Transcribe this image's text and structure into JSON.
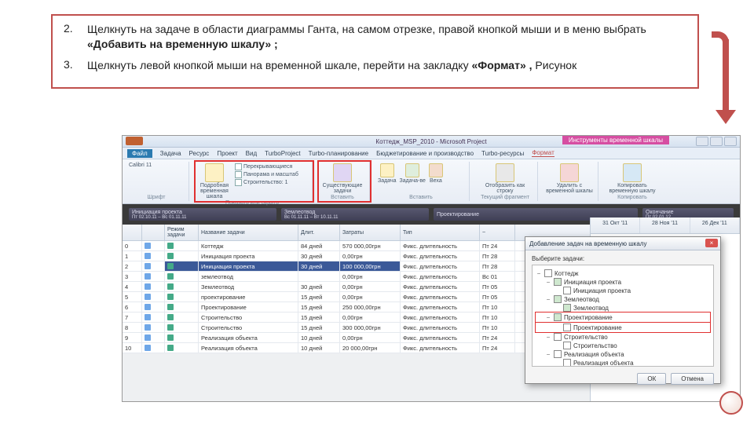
{
  "instructions": {
    "n2": "2.",
    "t2a": "Щелкнуть на задаче в области диаграммы Ганта, на самом отрезке, правой кнопкой мыши и в меню выбрать ",
    "t2b": "«Добавить на временную шкалу» ;",
    "n3": "3.",
    "t3a": "Щелкнуть левой кнопкой мыши на временной шкале, перейти на закладку ",
    "t3b": "«Формат» ,",
    "t3c": " Рисунок"
  },
  "titlebar": {
    "title": "Коттедж_MSP_2010 - Microsoft Project",
    "tool": "Инструменты временной шкалы"
  },
  "tabs": {
    "file": "Файл",
    "t": [
      "Задача",
      "Ресурс",
      "Проект",
      "Вид",
      "TurboProject",
      "Turbo-планирование",
      "Бюджетирование и производство",
      "Turbo-ресурсы"
    ],
    "active": "Формат"
  },
  "ribbon": {
    "g1": {
      "font": "Calibri",
      "size": "11",
      "label": "Шрифт"
    },
    "g2": {
      "btn": "Подробная временная шкала",
      "label": "Показать или скрыть",
      "c1": "Перекрывающиеся",
      "c2": "Панорама и масштаб",
      "c3": "Строительство: 1"
    },
    "g3": {
      "btn": "Существующие задачи",
      "label": "Вставить"
    },
    "g4": {
      "b1": "Задача",
      "b2": "Задача-ве",
      "b3": "Веха",
      "label": "Вставить"
    },
    "g5": {
      "b": "Отобразить как строку",
      "label": "Текущий фрагмент"
    },
    "g6": {
      "b": "Удалить с временной шкалы",
      "label": ""
    },
    "g7": {
      "b": "Копировать временную шкалу",
      "label": "Копировать"
    }
  },
  "segments": {
    "s1t": "Инициация проекта",
    "s1d": "Пт 02.10.11 – Вс 01.11.11",
    "s2t": "Землеотвод",
    "s2d": "Вс 01.11.11 – Вт 10.11.11",
    "s3t": "Проектирование",
    "s3d": "",
    "s4t": "Окончание",
    "s4d": "Пт 02.01.12"
  },
  "columns": {
    "c0": "",
    "c1": "Режим задачи",
    "c2": "Название задачи",
    "c3": "Длит.",
    "c4": "Затраты",
    "c5": "Тип",
    "c6": "~"
  },
  "rows": [
    {
      "id": "0",
      "name": "Коттедж",
      "dur": "84 дней",
      "cost": "570 000,00грн",
      "type": "Фикс. длительность",
      "st": "Пт 24"
    },
    {
      "id": "1",
      "name": "Инициация проекта",
      "dur": "30 дней",
      "cost": "0,00грн",
      "type": "Фикс. длительность",
      "st": "Пт 28",
      "sel": false
    },
    {
      "id": "2",
      "name": "Инициация проекта",
      "dur": "30 дней",
      "cost": "100 000,00грн",
      "type": "Фикс. длительность",
      "st": "Пт 28",
      "sel": true
    },
    {
      "id": "3",
      "name": "землеотвод",
      "dur": "",
      "cost": "0,00грн",
      "type": "Фикс. длительность",
      "st": "Вс 01"
    },
    {
      "id": "4",
      "name": "Землеотвод",
      "dur": "30 дней",
      "cost": "0,00грн",
      "type": "Фикс. длительность",
      "st": "Пт 05"
    },
    {
      "id": "5",
      "name": "проектирование",
      "dur": "15 дней",
      "cost": "0,00грн",
      "type": "Фикс. длительность",
      "st": "Пт 05"
    },
    {
      "id": "6",
      "name": "Проектирование",
      "dur": "15 дней",
      "cost": "250 000,00грн",
      "type": "Фикс. длительность",
      "st": "Пт 10"
    },
    {
      "id": "7",
      "name": "Строительство",
      "dur": "15 дней",
      "cost": "0,00грн",
      "type": "Фикс. длительность",
      "st": "Пт 10"
    },
    {
      "id": "8",
      "name": "Строительство",
      "dur": "15 дней",
      "cost": "300 000,00грн",
      "type": "Фикс. длительность",
      "st": "Пт 10"
    },
    {
      "id": "9",
      "name": "Реализация объекта",
      "dur": "10 дней",
      "cost": "0,00грн",
      "type": "Фикс. длительность",
      "st": "Пт 24"
    },
    {
      "id": "10",
      "name": "Реализация объекта",
      "dur": "10 дней",
      "cost": "20 000,00грн",
      "type": "Фикс. длительность",
      "st": "Пт 24"
    }
  ],
  "gantt_dates": [
    "31 Окт '11",
    "28 Ноя '11",
    "26 Дек '11"
  ],
  "dialog": {
    "title": "Добавление задач на временную шкалу",
    "label": "Выберите задачи:",
    "tree": [
      {
        "lvl": 0,
        "pm": "−",
        "chk": false,
        "txt": "Коттедж"
      },
      {
        "lvl": 1,
        "pm": "−",
        "chk": true,
        "txt": "Инициация проекта"
      },
      {
        "lvl": 2,
        "pm": "",
        "chk": false,
        "txt": "Инициация проекта"
      },
      {
        "lvl": 1,
        "pm": "−",
        "chk": true,
        "txt": "Землеотвод"
      },
      {
        "lvl": 2,
        "pm": "",
        "chk": true,
        "txt": "Землеотвод"
      },
      {
        "lvl": 1,
        "pm": "−",
        "chk": true,
        "txt": "Проектирование",
        "red": true
      },
      {
        "lvl": 2,
        "pm": "",
        "chk": false,
        "txt": "Проектирование",
        "red": true
      },
      {
        "lvl": 1,
        "pm": "−",
        "chk": false,
        "txt": "Строительство"
      },
      {
        "lvl": 2,
        "pm": "",
        "chk": false,
        "txt": "Строительство"
      },
      {
        "lvl": 1,
        "pm": "−",
        "chk": false,
        "txt": "Реализация объекта"
      },
      {
        "lvl": 2,
        "pm": "",
        "chk": false,
        "txt": "Реализация объекта"
      }
    ],
    "ok": "ОК",
    "cancel": "Отмена"
  }
}
